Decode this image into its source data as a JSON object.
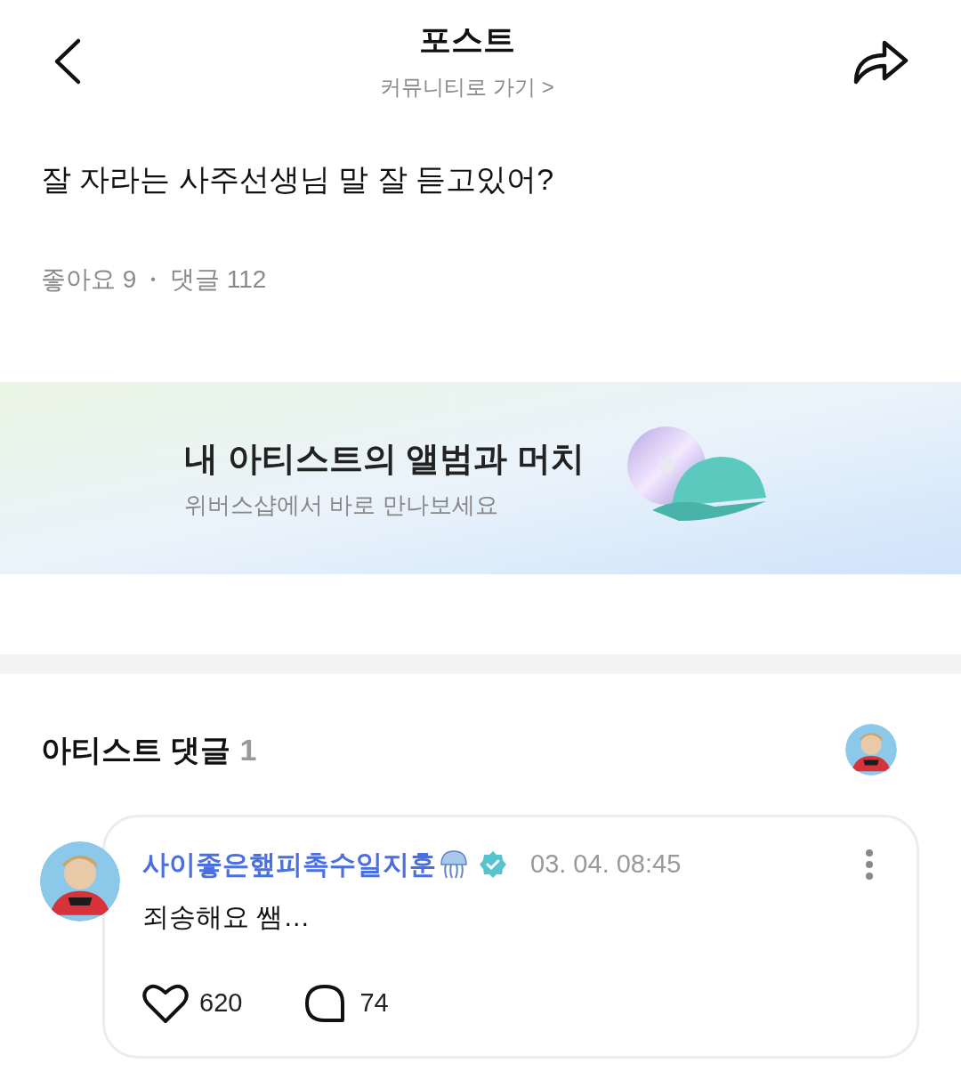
{
  "header": {
    "title": "포스트",
    "community_link": "커뮤니티로 가기 >"
  },
  "post": {
    "text": "잘 자라는 사주선생님 말 잘 듣고있어?",
    "likes": "좋아요 9",
    "separator": "•",
    "comments": "댓글 112"
  },
  "banner": {
    "title": "내 아티스트의 앨범과 머치",
    "subtitle": "위버스샵에서 바로 만나보세요"
  },
  "artist_comments": {
    "title": "아티스트 댓글",
    "count": "1",
    "comments": [
      {
        "author": "사이좋은햎피촉수일지훈",
        "verified": true,
        "time": "03. 04. 08:45",
        "text": "죄송해요 쌤…",
        "likes": "620",
        "replies": "74",
        "liked": false
      }
    ]
  }
}
